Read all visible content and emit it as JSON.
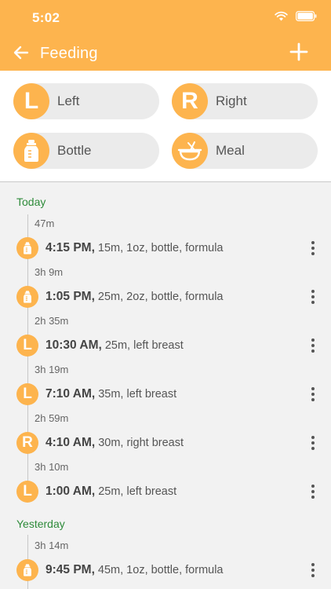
{
  "status_bar": {
    "time": "5:02"
  },
  "nav": {
    "title": "Feeding"
  },
  "quick": [
    {
      "badge": "L",
      "label": "Left"
    },
    {
      "badge": "R",
      "label": "Right"
    },
    {
      "badge_icon": "bottle-icon",
      "label": "Bottle"
    },
    {
      "badge_icon": "bowl-icon",
      "label": "Meal"
    }
  ],
  "sections": [
    {
      "title": "Today"
    },
    {
      "title": "Yesterday"
    }
  ],
  "intervals": [
    "47m",
    "3h 9m",
    "2h 35m",
    "3h 19m",
    "2h 59m",
    "3h 10m",
    "3h 14m"
  ],
  "entries": [
    {
      "type": "bottle",
      "time": "4:15 PM,",
      "details": "15m, 1oz, bottle, formula"
    },
    {
      "type": "bottle",
      "time": "1:05 PM,",
      "details": "25m, 2oz, bottle, formula"
    },
    {
      "type": "L",
      "time": "10:30 AM,",
      "details": "25m, left breast"
    },
    {
      "type": "L",
      "time": "7:10 AM,",
      "details": "35m, left breast"
    },
    {
      "type": "R",
      "time": "4:10 AM,",
      "details": "30m, right breast"
    },
    {
      "type": "L",
      "time": "1:00 AM,",
      "details": "25m, left breast"
    },
    {
      "type": "bottle",
      "time": "9:45 PM,",
      "details": "45m, 1oz, bottle, formula"
    }
  ],
  "colors": {
    "accent": "#FDB44E",
    "section": "#2e8b3a"
  }
}
